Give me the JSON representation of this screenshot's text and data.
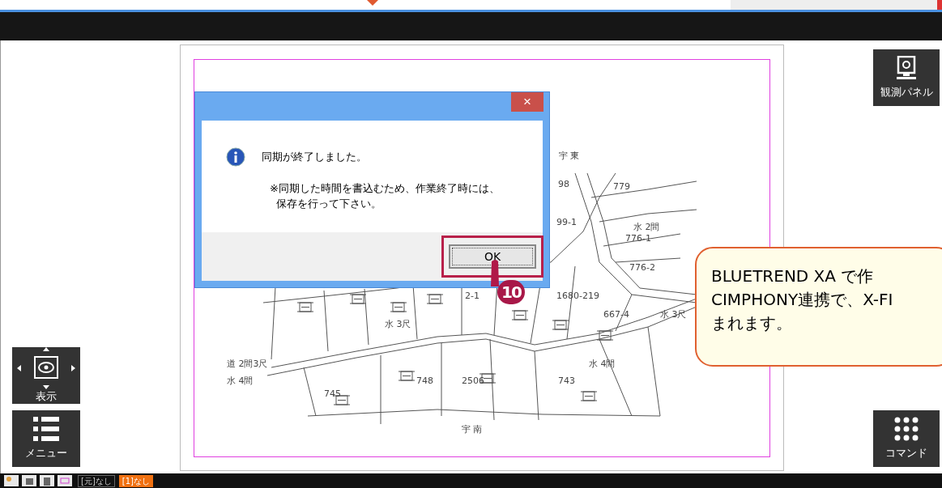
{
  "dialog": {
    "close_label": "×",
    "message": "同期が終了しました。",
    "note_lines": [
      "※同期した時間を書込むため、作業終了時には、",
      "保存を行って下さい。"
    ],
    "ok_label": "OK"
  },
  "step_marker": "10",
  "callout_lines": [
    "BLUETREND XA で作",
    "CIMPHONY連携で、X-FI",
    "まれます。"
  ],
  "side_buttons": {
    "observation_panel": "観測パネル",
    "view": "表示",
    "menu": "メニュー",
    "command": "コマンド"
  },
  "map_labels": [
    "宇 東",
    "98",
    "779",
    "99-1",
    "水 2間",
    "776-1",
    "776-2",
    "2-1",
    "1680-219",
    "667-4",
    "水 3尺",
    "水 3尺",
    "道 2間3尺",
    "水 4間",
    "水 4間",
    "748",
    "2506",
    "743",
    "745",
    "宇 南"
  ],
  "status_items": [
    {
      "label": "[元]なし",
      "highlighted": false
    },
    {
      "label": "[1]なし",
      "highlighted": true
    }
  ]
}
